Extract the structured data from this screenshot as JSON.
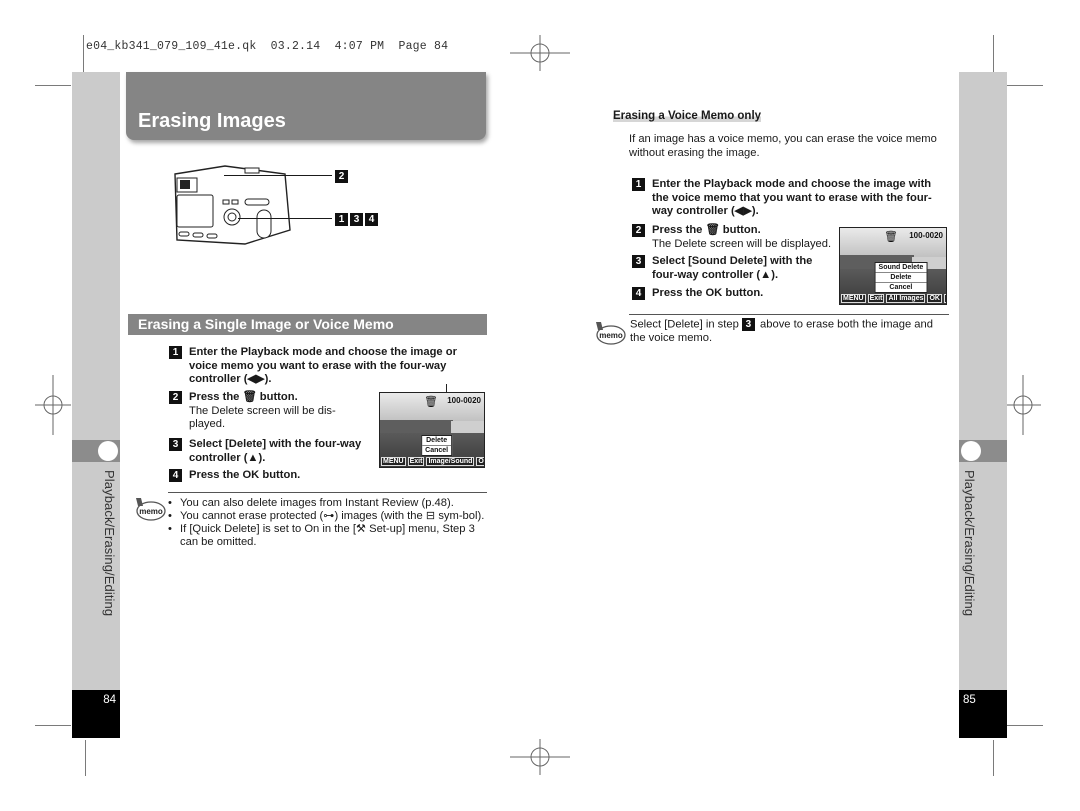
{
  "slug": {
    "file": "e04_kb341_079_109_41e.qk",
    "date": "03.2.14",
    "time": "4:07 PM",
    "page": "Page 84"
  },
  "left_page": {
    "title": "Erasing Images",
    "camera_callouts": [
      {
        "badges": [
          "2"
        ]
      },
      {
        "badges": [
          "1",
          "3",
          "4"
        ]
      }
    ],
    "section_title": "Erasing a Single Image or Voice Memo",
    "steps": [
      {
        "num": "1",
        "bold": "Enter the Playback mode and choose the image or voice memo you want to erase with the four-way controller (◀▶).",
        "normal": ""
      },
      {
        "num": "2",
        "bold": "Press the 🗑 button.",
        "normal": "The Delete screen will be dis-played."
      },
      {
        "num": "3",
        "bold": "Select [Delete] with the four-way controller (▲).",
        "normal": ""
      },
      {
        "num": "4",
        "bold": "Press the OK button.",
        "normal": ""
      }
    ],
    "lcd": {
      "file_number": "100-0020",
      "menu": [
        "Delete",
        "Cancel"
      ],
      "footer": [
        "MENU",
        "Exit",
        "Image/Sound",
        "OK",
        "Ok"
      ]
    },
    "memo_label": "memo",
    "memo_bullets": [
      "You can also delete images from Instant Review (p.48).",
      "You cannot erase protected (⊶) images (with the ⊟ sym-bol).",
      "If [Quick Delete] is set to On in the [⚒ Set-up] menu, Step 3 can be omitted."
    ],
    "side_label": "Playback/Erasing/Editing",
    "page_number": "84"
  },
  "right_page": {
    "sub_heading": "Erasing a Voice Memo only",
    "intro": "If an image has a voice memo, you can erase the voice memo without erasing the image.",
    "steps": [
      {
        "num": "1",
        "bold": "Enter the Playback mode and choose the image with the voice memo that you want to erase with the four-way controller (◀▶).",
        "normal": ""
      },
      {
        "num": "2",
        "bold": "Press the 🗑 button.",
        "normal": "The Delete screen will be displayed."
      },
      {
        "num": "3",
        "bold": "Select [Sound Delete] with the four-way controller (▲).",
        "normal": ""
      },
      {
        "num": "4",
        "bold": "Press the OK button.",
        "normal": ""
      }
    ],
    "lcd": {
      "file_number": "100-0020",
      "menu": [
        "Sound Delete",
        "Delete",
        "Cancel"
      ],
      "footer": [
        "MENU",
        "Exit",
        "All Images",
        "OK",
        "Ok"
      ]
    },
    "memo_label": "memo",
    "memo_text_pre": "Select [Delete] in step",
    "memo_step": "3",
    "memo_text_post": "above to erase both the image and the voice memo.",
    "side_label": "Playback/Erasing/Editing",
    "page_number": "85"
  }
}
